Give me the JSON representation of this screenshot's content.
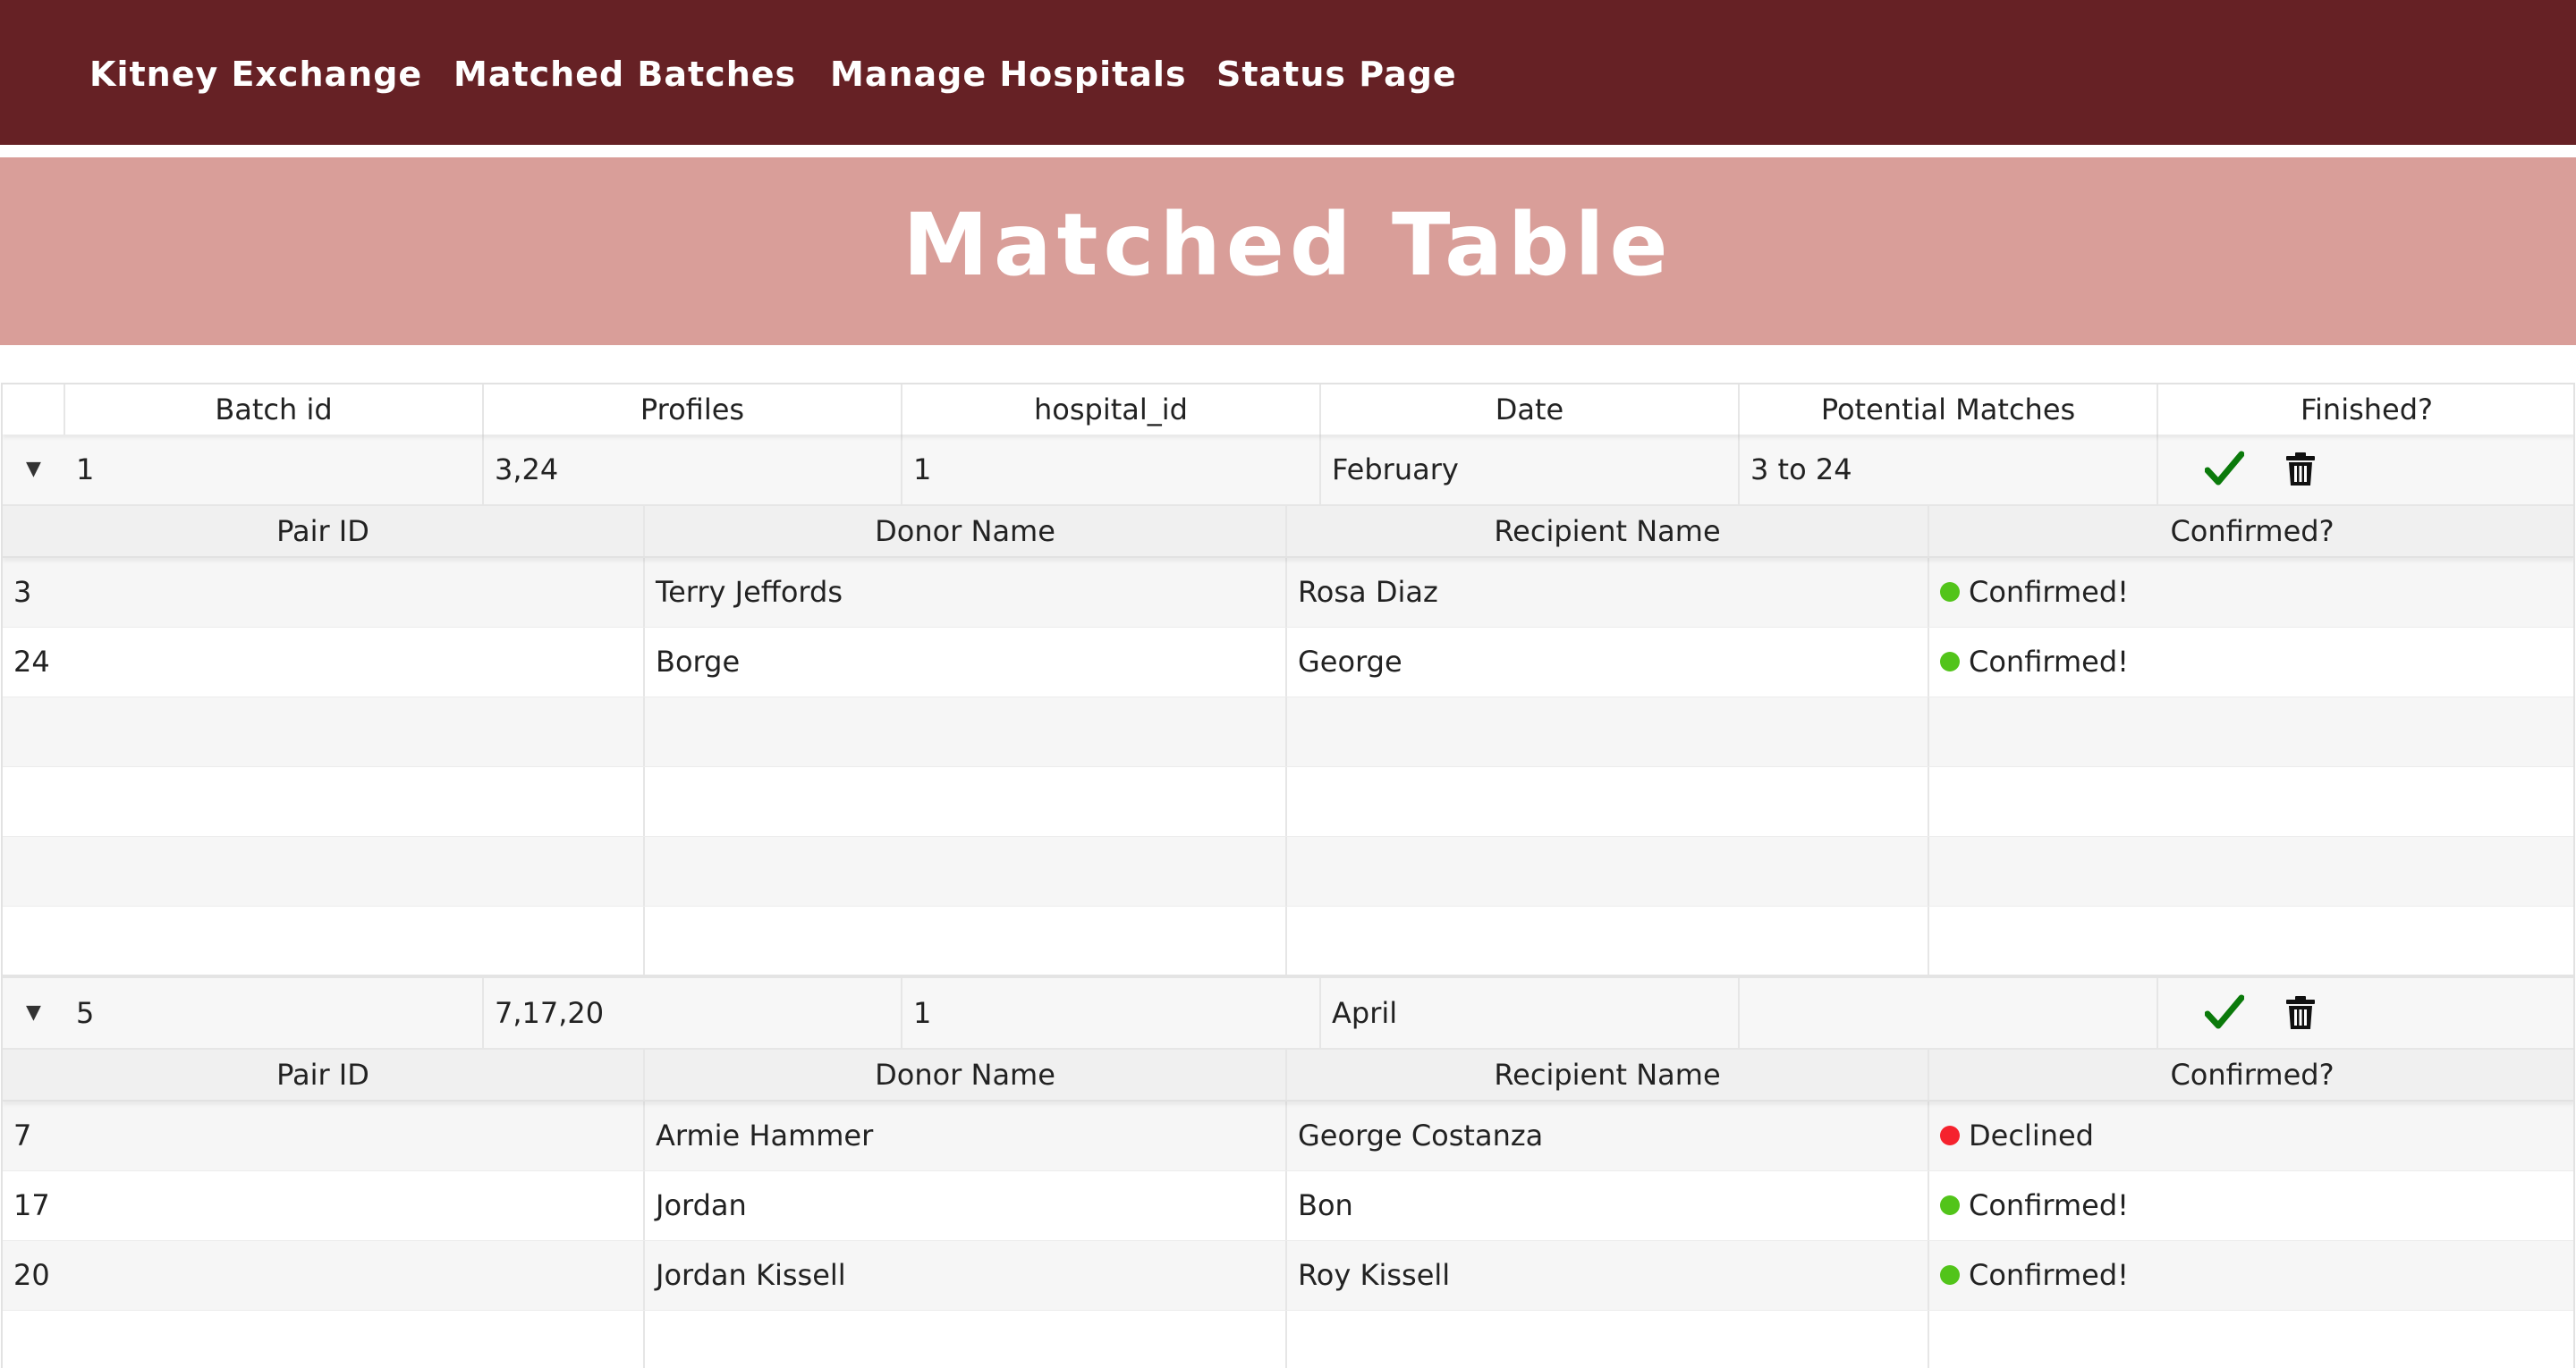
{
  "nav": {
    "items": [
      {
        "label": "Kitney Exchange"
      },
      {
        "label": "Matched Batches"
      },
      {
        "label": "Manage Hospitals"
      },
      {
        "label": "Status Page"
      }
    ]
  },
  "banner": {
    "title": "Matched Table"
  },
  "master": {
    "columns": [
      "Batch id",
      "Profiles",
      "hospital_id",
      "Date",
      "Potential Matches",
      "Finished?"
    ],
    "detail_columns": [
      "Pair ID",
      "Donor Name",
      "Recipient Name",
      "Confirmed?"
    ],
    "batches": [
      {
        "batch_id": "1",
        "profiles": "3,24",
        "hospital_id": "1",
        "date": "February",
        "potential_matches": "3 to 24",
        "pairs": [
          {
            "pair_id": "3",
            "donor": "Terry Jeffords",
            "recipient": "Rosa Diaz",
            "status": "Confirmed!"
          },
          {
            "pair_id": "24",
            "donor": "Borge",
            "recipient": "George",
            "status": "Confirmed!"
          }
        ]
      },
      {
        "batch_id": "5",
        "profiles": "7,17,20",
        "hospital_id": "1",
        "date": "April",
        "potential_matches": "",
        "pairs": [
          {
            "pair_id": "7",
            "donor": "Armie Hammer",
            "recipient": "George Costanza",
            "status": "Declined"
          },
          {
            "pair_id": "17",
            "donor": "Jordan",
            "recipient": "Bon",
            "status": "Confirmed!"
          },
          {
            "pair_id": "20",
            "donor": "Jordan Kissell",
            "recipient": "Roy Kissell",
            "status": "Confirmed!"
          }
        ]
      }
    ]
  },
  "icons": {
    "finish": "checkmark-icon",
    "delete": "trash-icon",
    "expand": "caret-down-icon"
  },
  "colors": {
    "navbar": "#662125",
    "banner": "#d99e99",
    "confirmed": "#52c41a",
    "declined": "#f5222d",
    "check": "#0b7a0b"
  }
}
